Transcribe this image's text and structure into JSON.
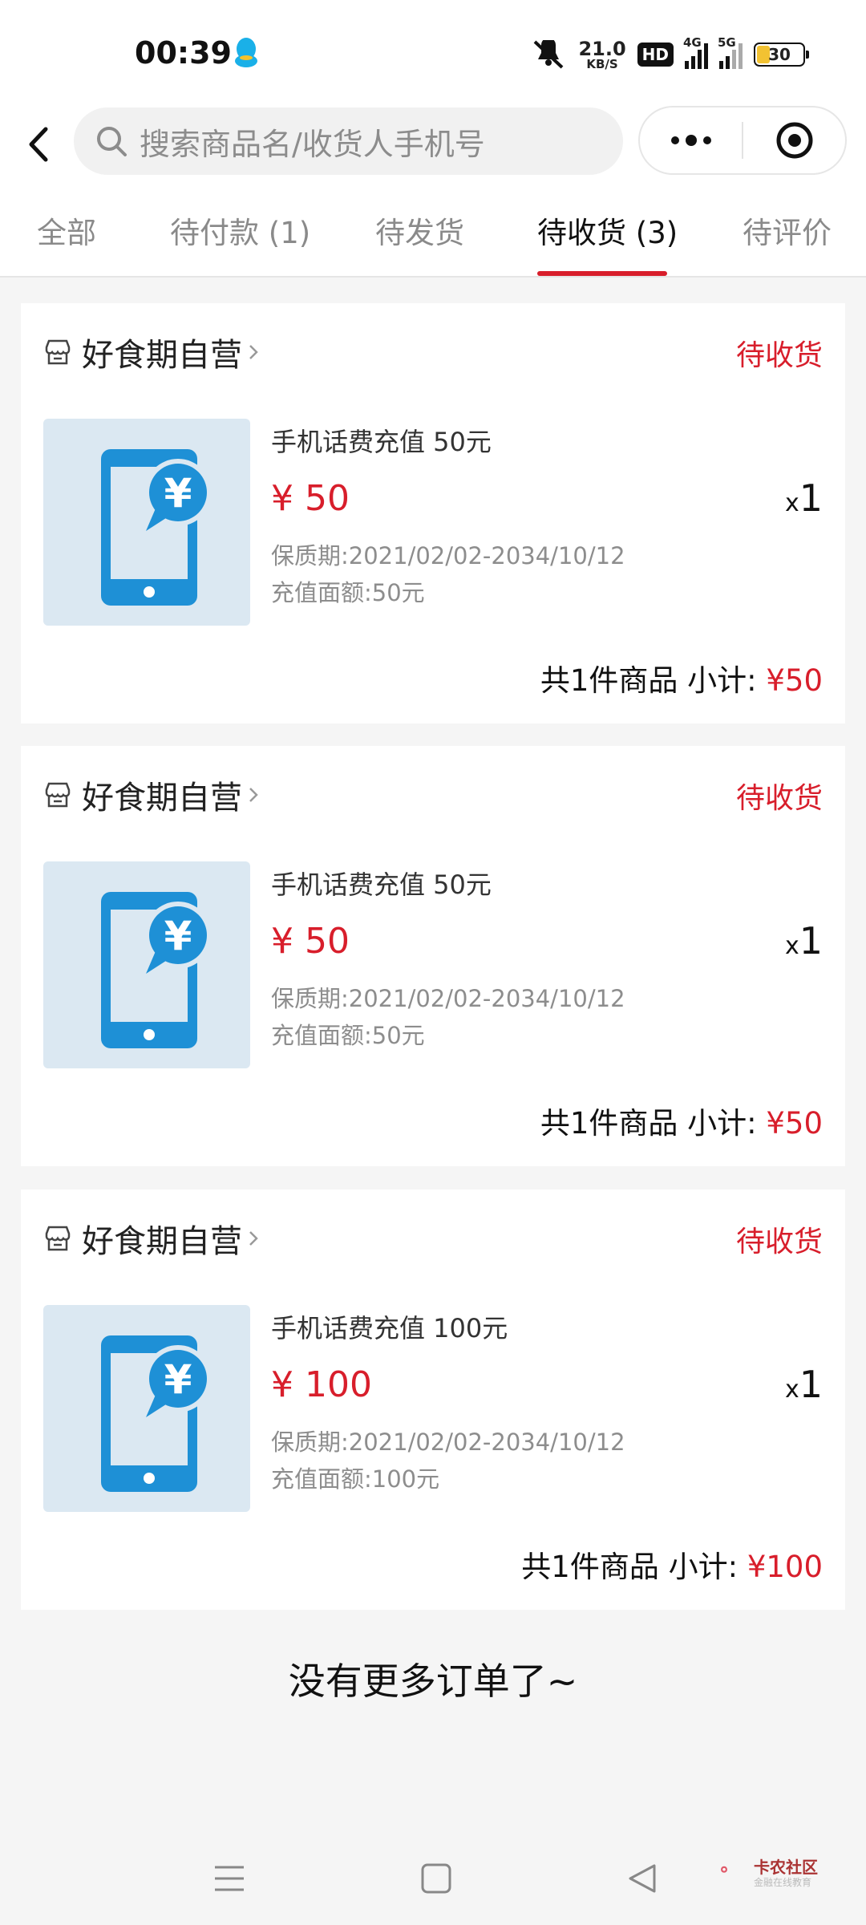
{
  "status_bar": {
    "time": "00:39",
    "net_speed_value": "21.0",
    "net_speed_unit": "KB/S",
    "hd_label": "HD",
    "sim1_label": "4G",
    "sim2_label": "5G",
    "battery": "30"
  },
  "header": {
    "search_placeholder": "搜索商品名/收货人手机号"
  },
  "tabs": [
    {
      "label": "全部"
    },
    {
      "label": "待付款 (1)"
    },
    {
      "label": "待发货"
    },
    {
      "label": "待收货 (3)"
    },
    {
      "label": "待评价"
    }
  ],
  "orders": [
    {
      "shop": "好食期自营",
      "status": "待收货",
      "product": "手机话费充值 50元",
      "price": "¥ 50",
      "qty_prefix": "x",
      "qty": "1",
      "validity": "保质期:2021/02/02-2034/10/12",
      "face_value": "充值面额:50元",
      "subtotal_label": "共1件商品 小计: ",
      "subtotal_amount": "¥50"
    },
    {
      "shop": "好食期自营",
      "status": "待收货",
      "product": "手机话费充值 50元",
      "price": "¥ 50",
      "qty_prefix": "x",
      "qty": "1",
      "validity": "保质期:2021/02/02-2034/10/12",
      "face_value": "充值面额:50元",
      "subtotal_label": "共1件商品 小计: ",
      "subtotal_amount": "¥50"
    },
    {
      "shop": "好食期自营",
      "status": "待收货",
      "product": "手机话费充值 100元",
      "price": "¥ 100",
      "qty_prefix": "x",
      "qty": "1",
      "validity": "保质期:2021/02/02-2034/10/12",
      "face_value": "充值面额:100元",
      "subtotal_label": "共1件商品 小计: ",
      "subtotal_amount": "¥100"
    }
  ],
  "footer_text": "没有更多订单了~",
  "watermark": {
    "title": "卡农社区",
    "subtitle": "金融在线教育"
  },
  "colors": {
    "accent": "#d81e2b",
    "phone_icon": "#1e90d6",
    "thumb_bg": "#dbe8f2"
  }
}
